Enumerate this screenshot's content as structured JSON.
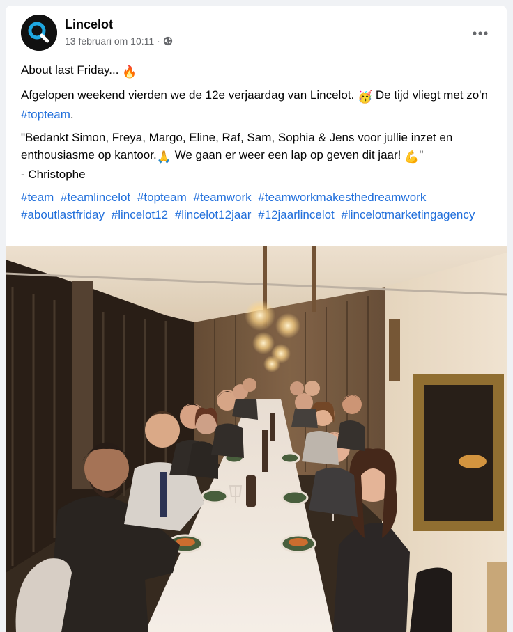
{
  "post": {
    "page_name": "Lincelot",
    "timestamp": "13 februari om 10:11",
    "separator": "·",
    "audience_icon": "globe-icon",
    "more_icon": "more-horizontal-icon",
    "line1": {
      "text": "About last Friday...",
      "emoji": "🔥"
    },
    "line2": {
      "text_a": "Afgelopen weekend vierden we de 12e verjaardag van Lincelot.",
      "emoji": "🥳",
      "text_b": "De tijd vliegt met zo'n",
      "hashtag": "#topteam",
      "text_c": "."
    },
    "line3": {
      "text_a": "\"Bedankt Simon, Freya, Margo, Eline, Raf, Sam, Sophia & Jens voor jullie inzet en enthousiasme op kantoor.",
      "emoji_pray": "🙏",
      "text_b": "We gaan er weer een lap op geven dit jaar!",
      "emoji_muscle": "💪",
      "text_c": "\"",
      "signature": "- Christophe"
    },
    "hashtags": [
      "#team",
      "#teamlincelot",
      "#topteam",
      "#teamwork",
      "#teamworkmakesthedreamwork",
      "#aboutlastfriday",
      "#lincelot12",
      "#lincelot12jaar",
      "#12jaarlincelot",
      "#lincelotmarketingagency"
    ],
    "photo_icon": "team-dinner-photo",
    "colors": {
      "link": "#216fdb",
      "secondary_text": "#65676b",
      "avatar_ring": "#1ea7e1"
    }
  }
}
